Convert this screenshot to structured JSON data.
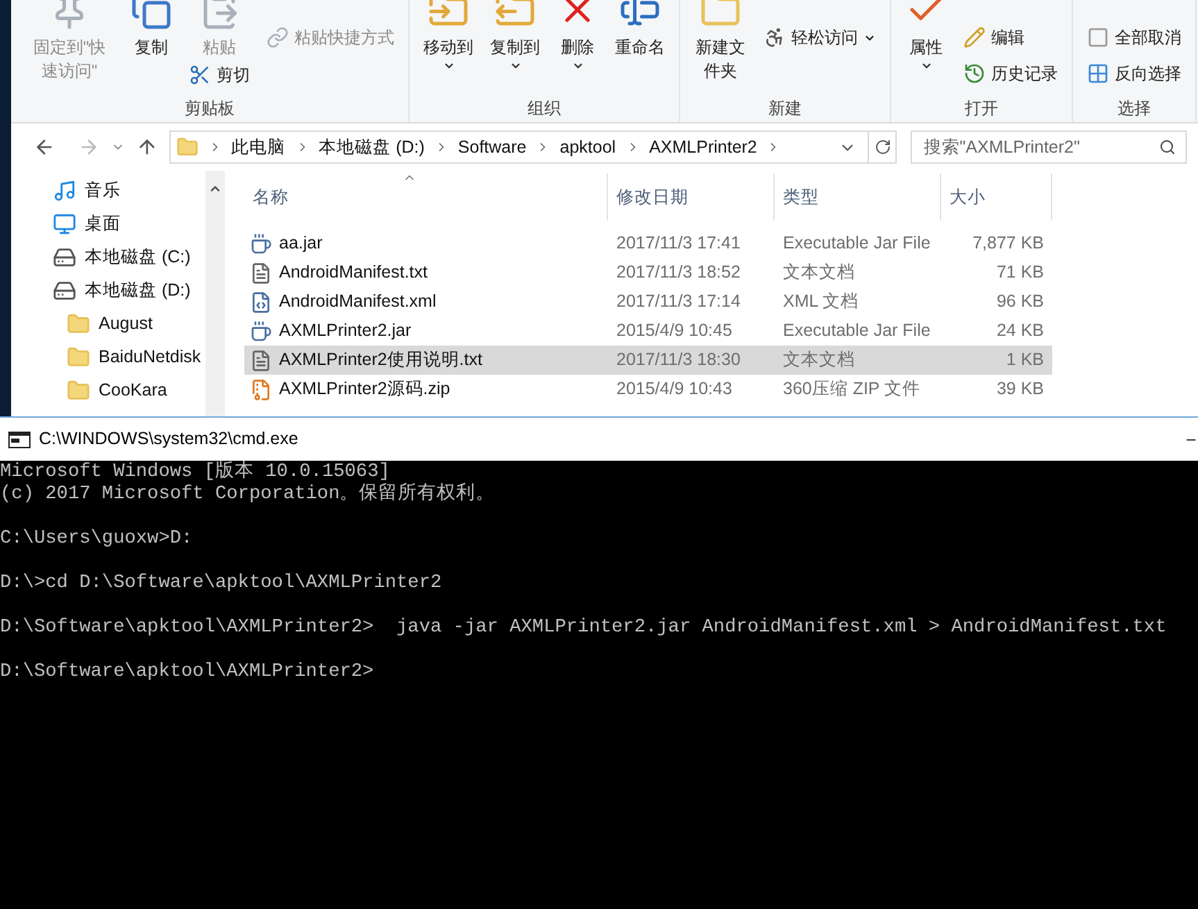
{
  "ribbon": {
    "groups": [
      {
        "label": "剪贴板",
        "columns": [
          {
            "kind": "large",
            "buttons": [
              {
                "label": "固定到\"快速访问\"",
                "disabled": true,
                "dropdown": false
              }
            ]
          },
          {
            "kind": "large",
            "buttons": [
              {
                "label": "复制",
                "disabled": false,
                "dropdown": false
              }
            ]
          },
          {
            "kind": "mixed",
            "buttons": [
              {
                "label": "粘贴",
                "disabled": true,
                "dropdown": false
              },
              {
                "label": "剪切",
                "disabled": false,
                "dropdown": false
              }
            ]
          },
          {
            "kind": "small",
            "buttons": [
              {
                "label": "粘贴快捷方式",
                "disabled": true,
                "dropdown": false
              }
            ]
          }
        ]
      },
      {
        "label": "组织",
        "columns": [
          {
            "kind": "large",
            "buttons": [
              {
                "label": "移动到",
                "disabled": false,
                "dropdown": true
              }
            ]
          },
          {
            "kind": "large",
            "buttons": [
              {
                "label": "复制到",
                "disabled": false,
                "dropdown": true
              }
            ]
          },
          {
            "kind": "large",
            "buttons": [
              {
                "label": "删除",
                "disabled": false,
                "dropdown": true
              }
            ]
          },
          {
            "kind": "large",
            "buttons": [
              {
                "label": "重命名",
                "disabled": false,
                "dropdown": false
              }
            ]
          }
        ]
      },
      {
        "label": "新建",
        "columns": [
          {
            "kind": "large",
            "buttons": [
              {
                "label": "新建文件夹",
                "disabled": false,
                "dropdown": false
              }
            ]
          },
          {
            "kind": "small",
            "buttons": [
              {
                "label": "轻松访问",
                "disabled": false,
                "dropdown": true
              }
            ]
          }
        ]
      },
      {
        "label": "打开",
        "columns": [
          {
            "kind": "large",
            "buttons": [
              {
                "label": "属性",
                "disabled": false,
                "dropdown": true
              }
            ]
          },
          {
            "kind": "small",
            "buttons": [
              {
                "label": "编辑",
                "disabled": false,
                "dropdown": false
              },
              {
                "label": "历史记录",
                "disabled": false,
                "dropdown": false
              }
            ]
          }
        ]
      },
      {
        "label": "选择",
        "columns": [
          {
            "kind": "small",
            "buttons": [
              {
                "label": "全部取消",
                "disabled": false,
                "dropdown": false
              },
              {
                "label": "反向选择",
                "disabled": false,
                "dropdown": false
              }
            ]
          }
        ]
      }
    ]
  },
  "address": {
    "crumbs": [
      "此电脑",
      "本地磁盘 (D:)",
      "Software",
      "apktool",
      "AXMLPrinter2"
    ],
    "search_placeholder": "搜索\"AXMLPrinter2\""
  },
  "sidebar": {
    "items": [
      {
        "label": "音乐",
        "kind": "music"
      },
      {
        "label": "桌面",
        "kind": "desktop"
      },
      {
        "label": "本地磁盘 (C:)",
        "kind": "systemdrive"
      },
      {
        "label": "本地磁盘 (D:)",
        "kind": "drive",
        "children": [
          {
            "label": "August",
            "kind": "folder"
          },
          {
            "label": "BaiduNetdisk",
            "kind": "folder"
          },
          {
            "label": "CooKara",
            "kind": "folder"
          }
        ]
      }
    ]
  },
  "table": {
    "columns": [
      "名称",
      "修改日期",
      "类型",
      "大小"
    ],
    "rows": [
      {
        "name": "aa.jar",
        "kind": "jar",
        "date": "2017/11/3 17:41",
        "type": "Executable Jar File",
        "size": "7,877 KB",
        "selected": false
      },
      {
        "name": "AndroidManifest.txt",
        "kind": "txt",
        "date": "2017/11/3 18:52",
        "type": "文本文档",
        "size": "71 KB",
        "selected": false
      },
      {
        "name": "AndroidManifest.xml",
        "kind": "xml",
        "date": "2017/11/3 17:14",
        "type": "XML 文档",
        "size": "96 KB",
        "selected": false
      },
      {
        "name": "AXMLPrinter2.jar",
        "kind": "jar",
        "date": "2015/4/9 10:45",
        "type": "Executable Jar File",
        "size": "24 KB",
        "selected": false
      },
      {
        "name": "AXMLPrinter2使用说明.txt",
        "kind": "txt",
        "date": "2017/11/3 18:30",
        "type": "文本文档",
        "size": "1 KB",
        "selected": true
      },
      {
        "name": "AXMLPrinter2源码.zip",
        "kind": "zip",
        "date": "2015/4/9 10:43",
        "type": "360压缩 ZIP 文件",
        "size": "39 KB",
        "selected": false
      }
    ]
  },
  "console": {
    "title": "C:\\WINDOWS\\system32\\cmd.exe",
    "blocks": [
      [
        "Microsoft Windows [版本 10.0.15063]",
        "(c) 2017 Microsoft Corporation。保留所有权利。"
      ],
      [
        "C:\\Users\\guoxw>D:"
      ],
      [
        "D:\\>cd D:\\Software\\apktool\\AXMLPrinter2"
      ],
      [
        "D:\\Software\\apktool\\AXMLPrinter2>  java -jar AXMLPrinter2.jar AndroidManifest.xml > AndroidManifest.txt"
      ],
      [
        "D:\\Software\\apktool\\AXMLPrinter2>"
      ]
    ]
  }
}
